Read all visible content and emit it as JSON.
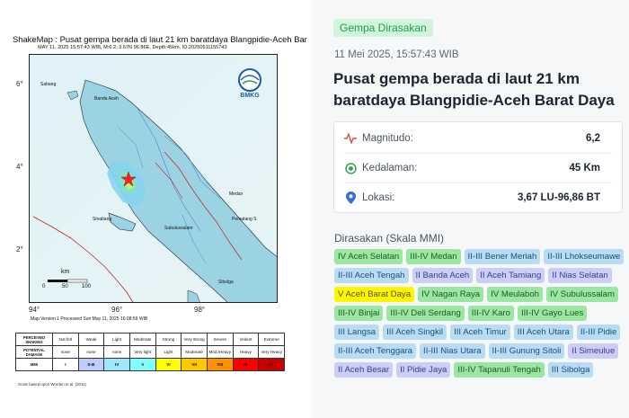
{
  "shakemap": {
    "title": "ShakeMap : Pusat gempa berada di laut 21 km baratdaya Blangpidie-Aceh Bar",
    "subtitle": "MAY 11, 2025 15:57:43 WIB, M:6.2, 3.67N 96.86E, Depth:45km, ID:20250511155743",
    "lat_ticks": [
      "6°",
      "4°",
      "2°"
    ],
    "lon_ticks": [
      "94°",
      "96°",
      "98°"
    ],
    "logo_text": "BMKG",
    "scale_bar": {
      "unit": "km",
      "ticks": [
        "0",
        "50",
        "100"
      ]
    },
    "places": [
      "Sabang",
      "Banda Aceh",
      "Sinabang",
      "Sibolga",
      "Pematang S",
      "Subulussalam",
      "Medan"
    ],
    "version_note": "Map Version 1 Processed Sun May 11, 2025 16:08:59 WIB",
    "scale_table": {
      "rows": [
        {
          "header": "PERCEIVED SHAKING",
          "cells": [
            "Not felt",
            "Weak",
            "Light",
            "Moderate",
            "Strong",
            "Very strong",
            "Severe",
            "Violent",
            "Extreme"
          ]
        },
        {
          "header": "POTENTIAL DAMAGE",
          "cells": [
            "none",
            "none",
            "none",
            "Very light",
            "Light",
            "Moderate",
            "Mod./Heavy",
            "Heavy",
            "Very Heavy"
          ]
        },
        {
          "header": "MMI",
          "cells": [
            "I",
            "II-III",
            "IV",
            "V",
            "VI",
            "VII",
            "VIII",
            "IX",
            "X+"
          ]
        }
      ],
      "mmi_colors": [
        "#ffffff",
        "#bfccff",
        "#a0e6ff",
        "#80ffff",
        "#ffff00",
        "#ffc800",
        "#ff9100",
        "#ff0000",
        "#c80000"
      ],
      "footer": "Scale based upon Worden et al. (2011)"
    }
  },
  "panel": {
    "badge": "Gempa Dirasakan",
    "date": "11 Mei 2025, 15:57:43 WIB",
    "headline": "Pusat gempa berada di laut 21 km baratdaya Blangpidie-Aceh Barat Daya",
    "info": {
      "magnitude": {
        "label": "Magnitudo:",
        "value": "6,2",
        "icon": "magnitude-wave-icon"
      },
      "depth": {
        "label": "Kedalaman:",
        "value": "45 Km",
        "icon": "target-icon"
      },
      "location": {
        "label": "Lokasi:",
        "value": "3,67 LU-96,86 BT",
        "icon": "location-pin-icon"
      }
    },
    "felt_title": "Dirasakan (Skala MMI)",
    "felt_regions": [
      {
        "text": "IV Aceh Selatan",
        "level": "green"
      },
      {
        "text": "III-IV Medan",
        "level": "green"
      },
      {
        "text": "II-III Bener Meriah",
        "level": "blue"
      },
      {
        "text": "II-III Lhokseumawe",
        "level": "blue"
      },
      {
        "text": "II-III Aceh Tengah",
        "level": "blue"
      },
      {
        "text": "II Banda Aceh",
        "level": "purple"
      },
      {
        "text": "II Aceh Tamiang",
        "level": "purple"
      },
      {
        "text": "II Nias Selatan",
        "level": "purple"
      },
      {
        "text": "V Aceh Barat Daya",
        "level": "yellow"
      },
      {
        "text": "IV Nagan Raya",
        "level": "green"
      },
      {
        "text": "IV Meulaboh",
        "level": "green"
      },
      {
        "text": "IV Subulussalam",
        "level": "green"
      },
      {
        "text": "III-IV Binjai",
        "level": "green"
      },
      {
        "text": "III-IV Deli Serdang",
        "level": "green"
      },
      {
        "text": "III-IV Karo",
        "level": "green"
      },
      {
        "text": "III-IV Gayo Lues",
        "level": "green"
      },
      {
        "text": "III Langsa",
        "level": "blue"
      },
      {
        "text": "III Aceh Singkil",
        "level": "blue"
      },
      {
        "text": "III Aceh Timur",
        "level": "blue"
      },
      {
        "text": "III Aceh Utara",
        "level": "blue"
      },
      {
        "text": "II-III Pidie",
        "level": "blue"
      },
      {
        "text": "II-III Aceh Tenggara",
        "level": "blue"
      },
      {
        "text": "II-III Nias Utara",
        "level": "blue"
      },
      {
        "text": "II-III Gunung Sitoli",
        "level": "blue"
      },
      {
        "text": "II Simeulue",
        "level": "purple"
      },
      {
        "text": "II Aceh Besar",
        "level": "purple"
      },
      {
        "text": "II Pidie Jaya",
        "level": "purple"
      },
      {
        "text": "III-IV Tapanuli Tengah",
        "level": "green"
      },
      {
        "text": "III Sibolga",
        "level": "blue"
      }
    ],
    "chip_colors": {
      "green": {
        "bg": "#9be7a2",
        "fg": "#185c22"
      },
      "blue": {
        "bg": "#b7dcf3",
        "fg": "#1d4f78"
      },
      "purple": {
        "bg": "#cbcef7",
        "fg": "#383d8c"
      },
      "yellow": {
        "bg": "#fff700",
        "fg": "#5a4d00"
      }
    }
  }
}
